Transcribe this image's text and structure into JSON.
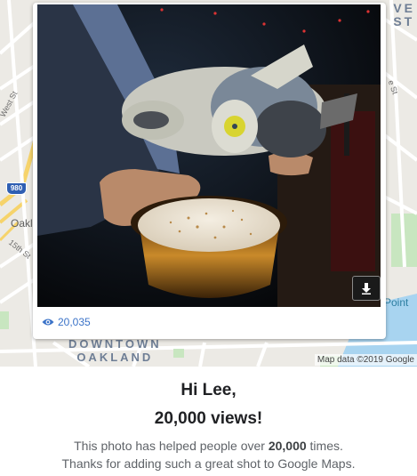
{
  "map": {
    "labels": {
      "west_st": "West St",
      "oakl": "Oakl",
      "fifteenth_st": "15th St",
      "district": "DOWNTOWN\nOAKLAND",
      "corner_text": "VE\nST",
      "point": "Point",
      "st_fragment": "e St"
    },
    "highway_shield": "980",
    "credit": "Map data ©2019 Google"
  },
  "photo_card": {
    "view_count": "20,035",
    "eye_icon": "eye-icon",
    "download_icon": "download-icon"
  },
  "message": {
    "greeting": "Hi Lee,",
    "headline": "20,000 views!",
    "line1_prefix": "This photo has helped people over ",
    "line1_count": "20,000",
    "line1_suffix": " times.",
    "line2": "Thanks for adding such a great shot to Google Maps."
  },
  "colors": {
    "link_blue": "#3b73c8",
    "heading_text": "#202124",
    "body_text": "#5f6368",
    "map_water": "#a8d4f0",
    "map_park": "#c8e6c0"
  }
}
